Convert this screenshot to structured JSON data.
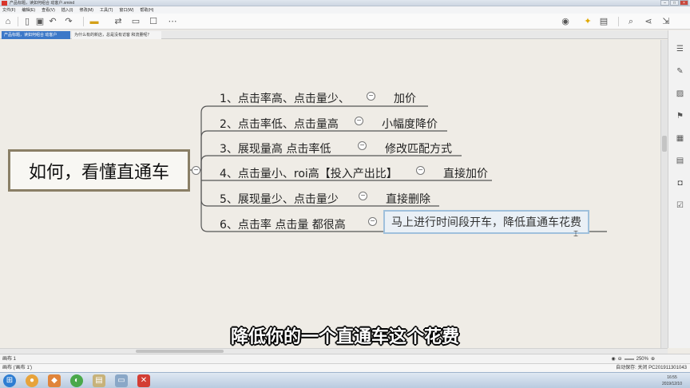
{
  "window": {
    "title": "产品标题，读如何组合 动客户.xmind"
  },
  "menu": [
    "文件(F)",
    "编辑(E)",
    "查看(V)",
    "插入(I)",
    "修改(M)",
    "工具(T)",
    "窗口(W)",
    "帮助(H)"
  ],
  "tabs": [
    {
      "label": "产品标题，读如何组合 动客户"
    },
    {
      "label": "为什么有的新店，总是没有访客 和流量呢？"
    }
  ],
  "mindmap": {
    "central": "如何，看懂直通车",
    "branches": [
      {
        "topic": "1、点击率高、点击量少、",
        "sub": "加价"
      },
      {
        "topic": "2、点击率低、点击量高",
        "sub": "小幅度降价"
      },
      {
        "topic": "3、展现量高    点击率低",
        "sub": "修改匹配方式"
      },
      {
        "topic": "4、点击量小、roi高【投入产出比】",
        "sub": "直接加价"
      },
      {
        "topic": "5、展现量少、点击量少",
        "sub": "直接删除"
      },
      {
        "topic": "6、点击率  点击量  都很高",
        "sub": "马上进行时间段开车，降低直通车花费"
      }
    ],
    "collapse_symbol": "−"
  },
  "sheet": {
    "tab_label": "画布 1"
  },
  "zoom": {
    "level": "250%"
  },
  "status": {
    "left": "画布 ('画布 1')",
    "right": "自动保存: 关闭     PC201911301043"
  },
  "clock": {
    "time": "16:55",
    "date": "2019/12/10"
  },
  "caption": "降低你的一个直通车这个花费",
  "colors": {
    "central_border": "#8a7f66",
    "selected_border": "#9fc0dc",
    "active_tab": "#3c78c8",
    "line": "#555555"
  }
}
